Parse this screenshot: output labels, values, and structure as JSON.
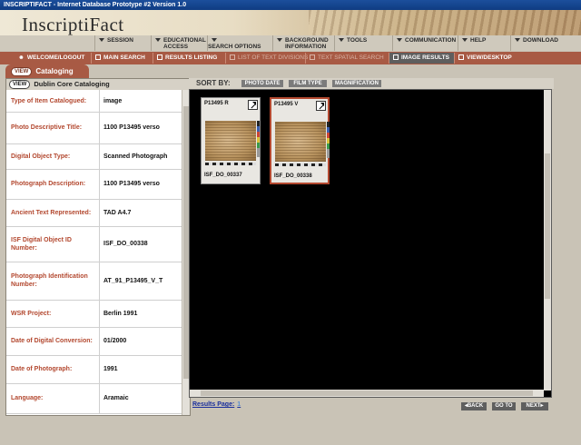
{
  "window": {
    "title": "INSCRIPTIFACT  -  Internet Database Prototype #2 Version 1.0"
  },
  "logo": {
    "text": "InscriptiFact"
  },
  "menu": [
    {
      "label": "SESSION"
    },
    {
      "label": "EDUCATIONAL ACCESS"
    },
    {
      "label": "SEARCH OPTIONS"
    },
    {
      "label": "BACKGROUND INFORMATION"
    },
    {
      "label": "TOOLS"
    },
    {
      "label": "COMMUNICATION"
    },
    {
      "label": "HELP"
    },
    {
      "label": "DOWNLOAD"
    }
  ],
  "nav": [
    {
      "label": "WELCOME/LOGOUT",
      "state": "enabled"
    },
    {
      "label": "MAIN SEARCH",
      "state": "enabled"
    },
    {
      "label": "RESULTS LISTING",
      "state": "enabled"
    },
    {
      "label": "LIST OF TEXT DIVISIONS",
      "state": "disabled"
    },
    {
      "label": "TEXT SPATIAL SEARCH",
      "state": "disabled"
    },
    {
      "label": "IMAGE RESULTS",
      "state": "active"
    },
    {
      "label": "VIEW/DESKTOP",
      "state": "enabled"
    }
  ],
  "cataloging": {
    "view_label": "VIEW",
    "tab_label": "Cataloging",
    "panel_view_label": "VIEW",
    "panel_title": "Dublin Core Cataloging",
    "rows": [
      {
        "label": "Type of Item Catalogued:",
        "value": "image"
      },
      {
        "label": "Photo Descriptive Title:",
        "value": "1100 P13495 verso"
      },
      {
        "label": "Digital Object Type:",
        "value": "Scanned Photograph"
      },
      {
        "label": "Photograph Description:",
        "value": "1100 P13495 verso"
      },
      {
        "label": "Ancient Text Represented:",
        "value": "TAD A4.7"
      },
      {
        "label": "ISF Digital Object ID Number:",
        "value": "ISF_DO_00338"
      },
      {
        "label": "Photograph Identification Number:",
        "value": "AT_91_P13495_V_T"
      },
      {
        "label": "WSR Project:",
        "value": "Berlin 1991"
      },
      {
        "label": "Date of Digital Conversion:",
        "value": "01/2000"
      },
      {
        "label": "Date of Photograph:",
        "value": "1991"
      },
      {
        "label": "Language:",
        "value": "Aramaic"
      }
    ]
  },
  "sort": {
    "label": "SORT BY:",
    "buttons": [
      "PHOTO DATE",
      "FILM TYPE",
      "MAGNIFICATION"
    ]
  },
  "thumbnails": [
    {
      "title": "P13495 R",
      "caption": "ISF_DO_00337",
      "selected": false
    },
    {
      "title": "P13495 V",
      "caption": "ISF_DO_00338",
      "selected": true
    }
  ],
  "footer": {
    "results_page_label": "Results Page:",
    "page_number": "1",
    "back_label": "BACK",
    "goto_label": "GO TO",
    "next_label": "NEXT"
  },
  "colors": {
    "accent": "#a85a44",
    "label_red": "#b3482f",
    "link_blue": "#1a2f9c"
  }
}
